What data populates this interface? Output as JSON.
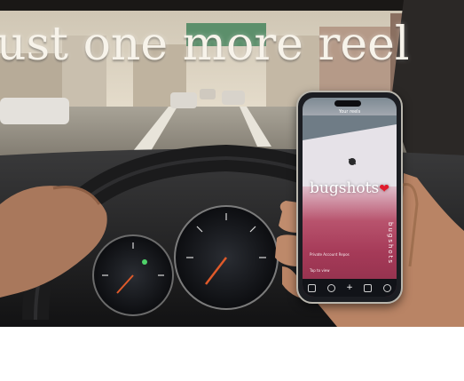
{
  "headline": "ust one more reel",
  "phone": {
    "top_label": "Your reels",
    "overlay_text": "bugshots",
    "heart_glyph": "❤",
    "vertical_text": "bugshots",
    "caption_line1": "Private Account Repos",
    "caption_line2": "Tap to view"
  },
  "colors": {
    "heart": "#e11b2c",
    "headline": "#f7f3ea"
  }
}
